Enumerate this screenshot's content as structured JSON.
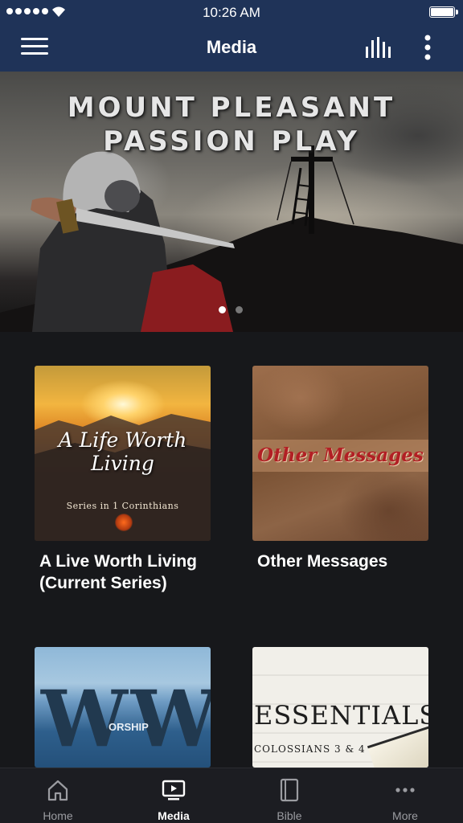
{
  "status_bar": {
    "time": "10:26 AM",
    "signal_icon": "signal-dots-icon",
    "wifi_icon": "wifi-icon",
    "battery_icon": "battery-icon",
    "battery_level": 1.0
  },
  "nav": {
    "title": "Media",
    "menu_icon": "hamburger-menu-icon",
    "audio_icon": "audio-bars-icon",
    "more_icon": "more-vertical-icon",
    "background_color": "#1f3358"
  },
  "banner": {
    "title_line1": "MOUNT PLEASANT",
    "title_line2": "PASSION PLAY",
    "active_slide": 1,
    "slide_count": 2
  },
  "cards": [
    {
      "title": "A Live Worth Living (Current Series)",
      "art_title": "A Life Worth Living",
      "art_subtitle": "Series in 1 Corinthians"
    },
    {
      "title": "Other Messages",
      "art_title": "Other Messages"
    },
    {
      "title": "",
      "art_title": "W",
      "art_subtitle": "ORSHIP"
    },
    {
      "title": "",
      "art_title": "ESSENTIALS",
      "art_subtitle": "COLOSSIANS 3 & 4"
    }
  ],
  "tabs": [
    {
      "label": "Home",
      "icon": "home-icon",
      "active": false
    },
    {
      "label": "Media",
      "icon": "media-tv-icon",
      "active": true
    },
    {
      "label": "Bible",
      "icon": "book-icon",
      "active": false
    },
    {
      "label": "More",
      "icon": "more-horizontal-icon",
      "active": false
    }
  ]
}
